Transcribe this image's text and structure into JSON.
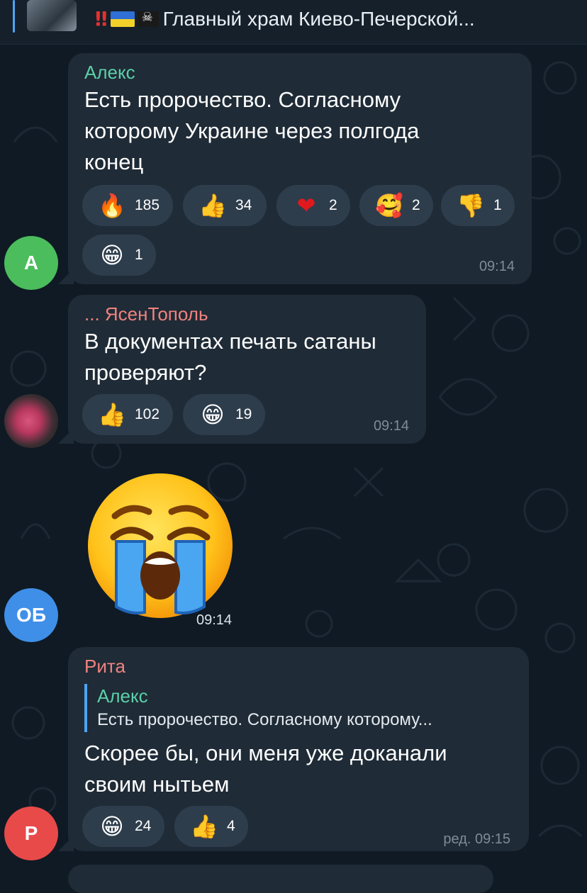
{
  "pinned": {
    "title": "Главный храм Киево-Печерской..."
  },
  "messages": [
    {
      "sender": "Алекс",
      "sender_color": "#5ccfa8",
      "avatar_letter": "А",
      "avatar_color": "#4bbd5c",
      "text_lines": [
        "Есть пророчество. Согласному",
        "которому Украине через полгода",
        "конец"
      ],
      "reactions": [
        {
          "icon": "fire-icon",
          "emoji": "🔥",
          "count": "185"
        },
        {
          "icon": "thumbs-up-icon",
          "emoji": "👍",
          "count": "34"
        },
        {
          "icon": "heart-icon",
          "emoji": "❤",
          "count": "2"
        },
        {
          "icon": "smiling-face-with-hearts-icon",
          "emoji": "🥰",
          "count": "2"
        },
        {
          "icon": "thumbs-down-icon",
          "emoji": "👎",
          "count": "1"
        },
        {
          "icon": "grin-icon",
          "emoji": "😁",
          "count": "1"
        }
      ],
      "time": "09:14"
    },
    {
      "sender": "... ЯсенТополь",
      "sender_color": "#f0837f",
      "text_lines": [
        "В документах печать сатаны",
        "проверяют?"
      ],
      "reactions": [
        {
          "icon": "thumbs-up-icon",
          "emoji": "👍",
          "count": "102"
        },
        {
          "icon": "grin-icon",
          "emoji": "😁",
          "count": "19"
        }
      ],
      "time": "09:14"
    },
    {
      "avatar_letter": "ОБ",
      "avatar_color": "#3f8fe8",
      "sticker": "loudly-crying-face-icon",
      "time": "09:14"
    },
    {
      "sender": "Рита",
      "sender_color": "#f0837f",
      "avatar_letter": "Р",
      "avatar_color": "#e84a4a",
      "reply": {
        "name": "Алекс",
        "text": "Есть пророчество. Согласному которому..."
      },
      "text_lines": [
        "Скорее бы, они меня уже доканали",
        "своим нытьем"
      ],
      "reactions": [
        {
          "icon": "grin-icon",
          "emoji": "😁",
          "count": "24"
        },
        {
          "icon": "thumbs-up-icon",
          "emoji": "👍",
          "count": "4"
        }
      ],
      "time": "ред. 09:15"
    }
  ],
  "colors": {
    "background": "#0f1a24",
    "bubble": "#1f2b36",
    "reaction_pill": "#2e3d4c",
    "accent": "#4ea4f6"
  }
}
